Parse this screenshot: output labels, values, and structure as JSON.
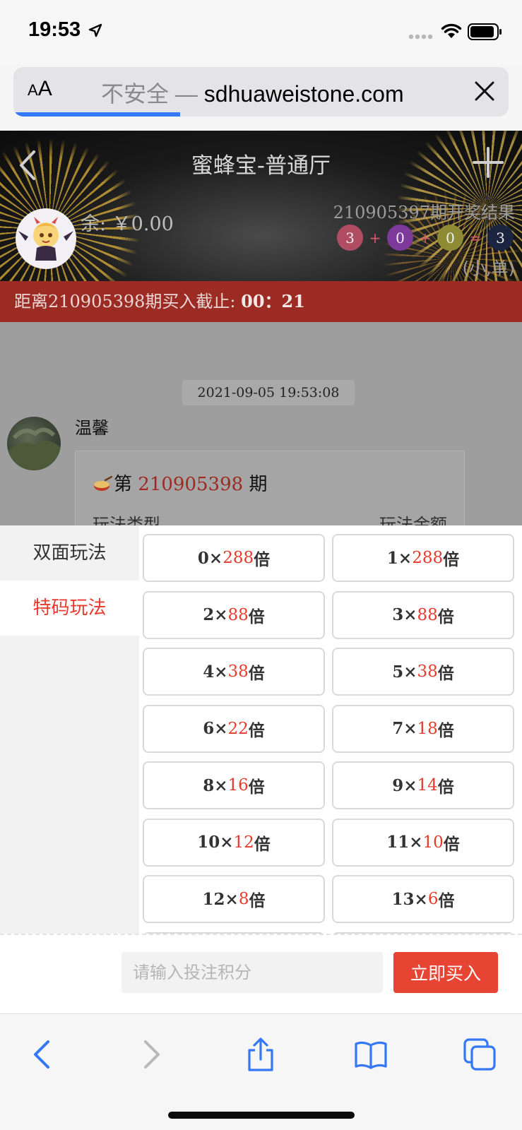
{
  "status_bar": {
    "time": "19:53"
  },
  "browser": {
    "aa_small": "A",
    "aa_big": "A",
    "insecure_label": "不安全 —",
    "domain": "sdhuaweistone.com",
    "load_progress": 0.33
  },
  "header": {
    "title": "蜜蜂宝-普通厅",
    "balance": "余: ￥0.00",
    "result_title": "210905397期开奖结果",
    "balls": [
      {
        "value": "3",
        "color": "#b14d63"
      },
      {
        "value": "0",
        "color": "#7e3a9b"
      },
      {
        "value": "0",
        "color": "#8f8a34"
      },
      {
        "value": "3",
        "color": "#1b2540"
      }
    ],
    "ops": [
      "+",
      "+",
      "="
    ],
    "result_summary": "(小,单)"
  },
  "deadline": {
    "label": "距离210905398期买入截止:",
    "countdown": "00：21"
  },
  "chat": {
    "timestamp": "2021-09-05 19:53:08",
    "name": "温馨",
    "bubble_prefix": "第",
    "issue": "210905398",
    "bubble_suffix": "期",
    "row_left": "玩法类型",
    "row_right": "玩法金额"
  },
  "panel": {
    "nav": [
      {
        "label": "双面玩法",
        "active": false
      },
      {
        "label": "特码玩法",
        "active": true
      }
    ],
    "odds": [
      {
        "num": "0",
        "mult": "288"
      },
      {
        "num": "1",
        "mult": "288"
      },
      {
        "num": "2",
        "mult": "88"
      },
      {
        "num": "3",
        "mult": "88"
      },
      {
        "num": "4",
        "mult": "38"
      },
      {
        "num": "5",
        "mult": "38"
      },
      {
        "num": "6",
        "mult": "22"
      },
      {
        "num": "7",
        "mult": "18"
      },
      {
        "num": "8",
        "mult": "16"
      },
      {
        "num": "9",
        "mult": "14"
      },
      {
        "num": "10",
        "mult": "12"
      },
      {
        "num": "11",
        "mult": "10"
      },
      {
        "num": "12",
        "mult": "8"
      },
      {
        "num": "13",
        "mult": "6"
      }
    ],
    "times_sign": "×",
    "bei": "倍",
    "input_placeholder": "请输入投注积分",
    "buy_label": "立即买入"
  },
  "toolbar": {
    "icons": [
      "back-icon",
      "forward-icon",
      "share-icon",
      "bookmarks-icon",
      "tabs-icon"
    ]
  },
  "colors": {
    "accent": "#e83b2e",
    "deadline_bar": "#9c2b24",
    "safari_blue": "#3478f6"
  }
}
